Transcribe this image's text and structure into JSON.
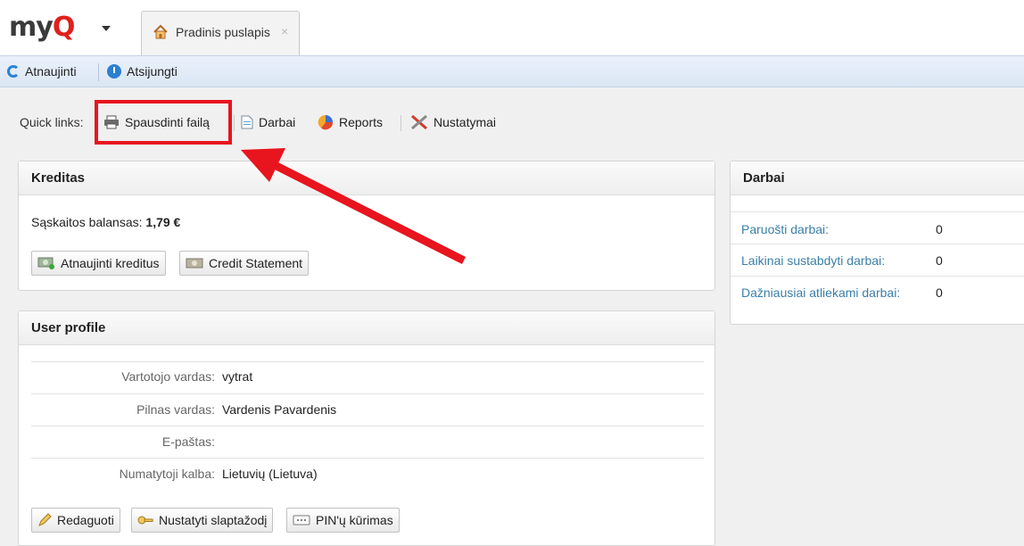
{
  "header": {
    "logo": "my",
    "logo_q": "Q",
    "tab_label": "Pradinis puslapis",
    "tab_close": "×"
  },
  "toolbar": {
    "refresh_label": "Atnaujinti",
    "logout_label": "Atsijungti"
  },
  "quick_links": {
    "label": "Quick links:",
    "items": [
      {
        "label": "Spausdinti failą",
        "icon": "printer-icon"
      },
      {
        "label": "Darbai",
        "icon": "document-icon"
      },
      {
        "label": "Reports",
        "icon": "pie-chart-icon"
      },
      {
        "label": "Nustatymai",
        "icon": "tools-icon"
      }
    ]
  },
  "credit": {
    "title": "Kreditas",
    "balance_label": "Sąskaitos balansas:",
    "balance_value": "1,79 €",
    "refill_button": "Atnaujinti kreditus",
    "statement_button": "Credit Statement"
  },
  "profile": {
    "title": "User profile",
    "fields": [
      {
        "label": "Vartotojo vardas:",
        "value": "vytrat"
      },
      {
        "label": "Pilnas vardas:",
        "value": "Vardenis Pavardenis"
      },
      {
        "label": "E-paštas:",
        "value": ""
      },
      {
        "label": "Numatytoji kalba:",
        "value": "Lietuvių (Lietuva)"
      }
    ],
    "edit_button": "Redaguoti",
    "password_button": "Nustatyti slaptažodį",
    "pin_button": "PIN'ų kūrimas"
  },
  "jobs": {
    "title": "Darbai",
    "rows": [
      {
        "label": "Paruošti darbai:",
        "value": "0"
      },
      {
        "label": "Laikinai sustabdyti darbai:",
        "value": "0"
      },
      {
        "label": "Dažniausiai atliekami darbai:",
        "value": "0"
      }
    ]
  },
  "colors": {
    "highlight": "#e8141e",
    "brand_red": "#e0201b",
    "link_blue": "#3a7fa8"
  }
}
